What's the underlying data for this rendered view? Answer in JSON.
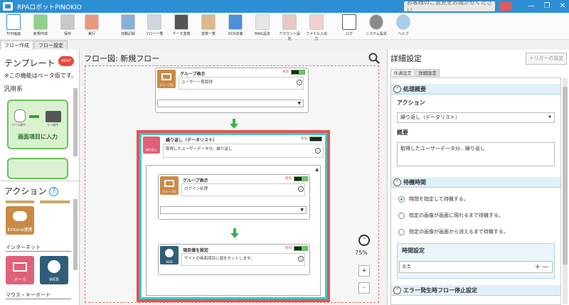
{
  "window": {
    "title": "RPAロボットPINOKIO",
    "feedback": "お客様のご意見をお聞かせください",
    "controls": [
      "—",
      "❐",
      "✕"
    ]
  },
  "toolbar": {
    "items": [
      {
        "label": "TOP画面",
        "icon": "top-screen-icon"
      },
      {
        "label": "新規作成",
        "icon": "new-file-icon"
      },
      {
        "label": "保存",
        "icon": "save-icon"
      },
      {
        "label": "実行",
        "icon": "run-icon"
      },
      {
        "label": "自動記録",
        "icon": "auto-record-icon"
      },
      {
        "label": "フロー一覧",
        "icon": "flow-list-icon"
      },
      {
        "label": "データ変数",
        "icon": "data-variable-icon"
      },
      {
        "label": "変数一覧",
        "icon": "variable-list-icon"
      },
      {
        "label": "OCR定義",
        "icon": "ocr-icon"
      },
      {
        "label": "MAIL設定",
        "icon": "mail-settings-icon"
      },
      {
        "label": "アカウント設定",
        "icon": "account-settings-icon"
      },
      {
        "label": "ファイル入出力",
        "icon": "file-io-icon"
      },
      {
        "label": "ログ",
        "icon": "log-icon"
      },
      {
        "label": "システム設定",
        "icon": "system-settings-icon"
      },
      {
        "label": "ヘルプ",
        "icon": "help-icon"
      }
    ]
  },
  "tabs": [
    "フロー作成",
    "フロー設定"
  ],
  "left": {
    "template_title": "テンプレート",
    "new_badge": "NEW!",
    "beta_note": "※この機能はベータ版です。",
    "category": "汎用系",
    "template_card": "画面項目に入力",
    "template_sub_labels": [
      "マウス操作",
      "キー操作"
    ],
    "action_title": "アクション",
    "action_help": "?",
    "actions_a": [
      {
        "label": "Kintone連携"
      }
    ],
    "cat_internet": "インターネット",
    "actions_b": [
      {
        "label": "メール"
      },
      {
        "label": "WEB"
      }
    ],
    "cat_mouse": "マウス・キーボード"
  },
  "center": {
    "header": "フロー図: 新規フロー",
    "zoom": "75%",
    "zoom_in": "+",
    "zoom_out": "-",
    "nodes": {
      "group1": {
        "title": "グループ表示",
        "icon_label": "グループ化",
        "enabled": "有効",
        "desc": "ユーザー一覧取得"
      },
      "loop": {
        "title": "繰り返し（データリスト）",
        "icon_label": "繰り返し",
        "enabled": "有効",
        "desc": "取得したユーザーデータ分、繰り返し"
      },
      "group2": {
        "title": "グループ表示",
        "icon_label": "グループ化",
        "enabled": "有効",
        "desc": "ログイン処理"
      },
      "setvalue": {
        "title": "項目値を設定",
        "icon_label": "WEB",
        "enabled": "有効",
        "desc": "サイトの画面項目に値をセットします。"
      }
    }
  },
  "right": {
    "title": "詳細設定",
    "trigger_button": "トリガーの設定",
    "tabs": [
      "共通設定",
      "詳細設定"
    ],
    "overview": {
      "head": "処理概要",
      "action_label": "アクション",
      "action_value": "繰り返し（データリスト）",
      "summary_label": "概要",
      "summary_value": "取得したユーザーデータ分、繰り返し"
    },
    "wait": {
      "head": "待機時間",
      "options": [
        {
          "label": "時間を指定して待機する。",
          "selected": true
        },
        {
          "label": "指定の画像が画面に現れるまで待機する。",
          "selected": false
        },
        {
          "label": "指定の画像が画面から消えるまで待機する。",
          "selected": false
        }
      ],
      "time_label": "時間設定",
      "time_value": "0.5"
    },
    "error": {
      "head": "エラー発生時フロー停止設定"
    }
  },
  "colors": {
    "titlebar": "#2d8fd3",
    "group_icon": "#c98a45",
    "loop_icon": "#e0607a",
    "web_icon": "#2f5d7a",
    "selection_border": "#e05555",
    "loop_border": "#3fc8c8",
    "arrow": "#3bb34a",
    "template_card": "#d9f1cf"
  }
}
